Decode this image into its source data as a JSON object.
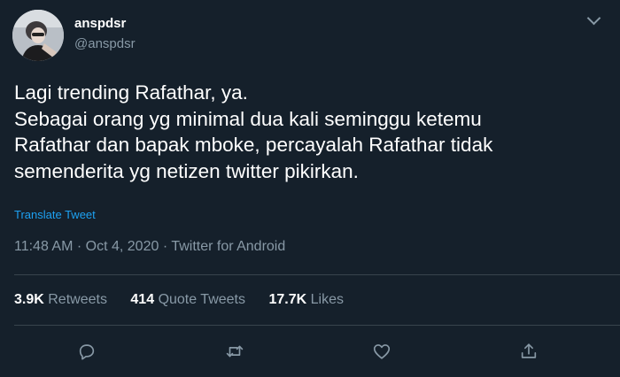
{
  "user": {
    "display_name": "anspdsr",
    "handle": "@anspdsr"
  },
  "tweet": {
    "lines": [
      "Lagi trending Rafathar, ya.",
      "Sebagai orang yg minimal dua kali seminggu ketemu",
      "Rafathar dan bapak mboke, percayalah Rafathar tidak",
      "semenderita yg netizen twitter pikirkan."
    ],
    "translate_label": "Translate Tweet",
    "time": "11:48 AM",
    "date": "Oct 4, 2020",
    "source": "Twitter for Android",
    "separator": "·"
  },
  "stats": {
    "retweets_count": "3.9K",
    "retweets_label": "Retweets",
    "quote_count": "414",
    "quote_label": "Quote Tweets",
    "likes_count": "17.7K",
    "likes_label": "Likes"
  },
  "icons": {
    "more": "chevron-down-icon",
    "reply": "reply-icon",
    "retweet": "retweet-icon",
    "like": "heart-icon",
    "share": "share-icon"
  },
  "colors": {
    "background": "#15202b",
    "text": "#ffffff",
    "secondary": "#8899a6",
    "link": "#1da1f2",
    "divider": "#38444d"
  }
}
